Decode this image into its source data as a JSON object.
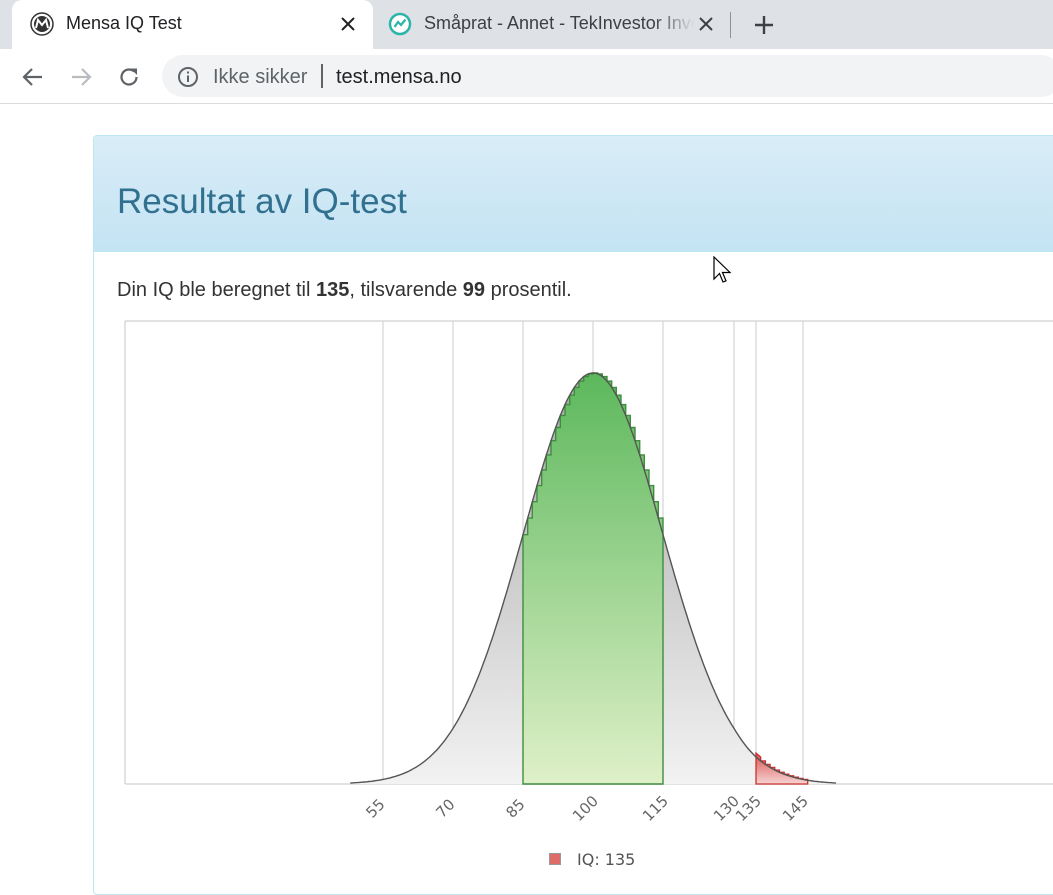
{
  "browser": {
    "tabs": [
      {
        "title": "Mensa IQ Test",
        "active": true
      },
      {
        "title": "Småprat - Annet - TekInvestor Investering",
        "active": false
      }
    ],
    "security_label": "Ikke sikker",
    "url": "test.mensa.no"
  },
  "page": {
    "title": "Resultat av IQ-test",
    "result_prefix": "Din IQ ble beregnet til ",
    "iq_value": "135",
    "result_middle": ", tilsvarende ",
    "percentile": "99",
    "result_suffix": " prosentil."
  },
  "chart_data": {
    "type": "area",
    "distribution": "normal",
    "mean": 100,
    "sd": 15,
    "x_tick_labels": [
      "55",
      "70",
      "85",
      "100",
      "115",
      "130",
      "135",
      "145"
    ],
    "x_ticks": [
      55,
      70,
      85,
      100,
      115,
      130,
      135,
      145
    ],
    "highlight_range_green": [
      85,
      115
    ],
    "highlight_from_red": 135,
    "legend": [
      {
        "label": "IQ: 135",
        "color": "#d9534f"
      }
    ],
    "legend_position": "bottom",
    "grid": true,
    "colors": {
      "gray": "#9a9a9a",
      "green": "#5cb85c",
      "red": "#d9534f"
    }
  }
}
